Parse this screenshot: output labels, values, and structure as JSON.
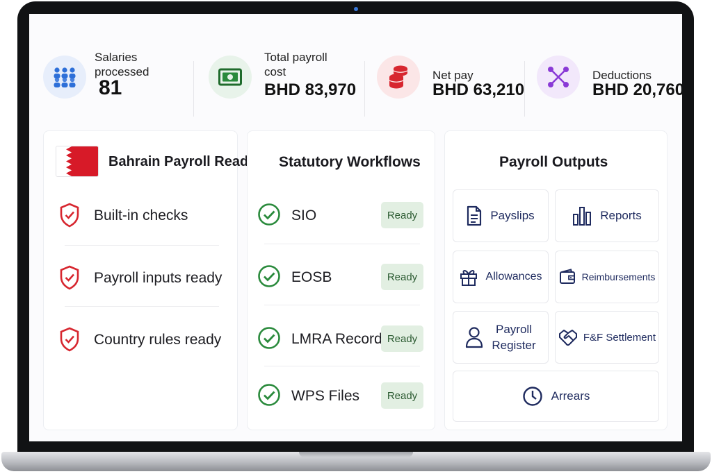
{
  "stats": [
    {
      "label_line1": "Salaries",
      "label_line2": "processed",
      "value": "81",
      "icon": "people-icon"
    },
    {
      "label_line1": "Total payroll",
      "label_line2": "cost",
      "value": "BHD 83,970",
      "icon": "cash-icon"
    },
    {
      "label_line1": "Net pay",
      "label_line2": "",
      "value": "BHD 63,210",
      "icon": "coins-icon"
    },
    {
      "label_line1": "Deductions",
      "label_line2": "",
      "value": "BHD 20,760",
      "icon": "network-icon"
    }
  ],
  "colors": {
    "accent_blue": "#2d6fd8",
    "green": "#2a8a3c",
    "red": "#d7262f",
    "purple": "#8a3ad6",
    "navy": "#1e2a5e"
  },
  "bahrain": {
    "title": "Bahrain Payroll Ready",
    "items": [
      "Built-in checks",
      "Payroll inputs ready",
      "Country rules ready"
    ]
  },
  "statutory": {
    "title": "Statutory Workflows",
    "items": [
      {
        "label": "SIO",
        "status": "Ready"
      },
      {
        "label": "EOSB",
        "status": "Ready"
      },
      {
        "label": "LMRA Records",
        "status": "Ready"
      },
      {
        "label": "WPS Files",
        "status": "Ready"
      }
    ]
  },
  "outputs": {
    "title": "Payroll Outputs",
    "payslips": "Payslips",
    "reports": "Reports",
    "allowances": "Allowances",
    "reimbursements": "Reimbursements",
    "payroll_register_line1": "Payroll",
    "payroll_register_line2": "Register",
    "ff_settlement": "F&F Settlement",
    "arrears": "Arrears"
  }
}
